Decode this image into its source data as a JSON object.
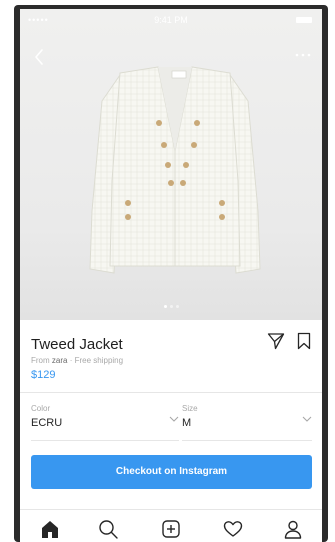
{
  "status_bar": {
    "signal": "•••••",
    "time": "9:41 PM"
  },
  "product": {
    "title": "Tweed Jacket",
    "from_prefix": "From",
    "brand": "zara",
    "shipping": "· Free shipping",
    "price": "$129",
    "image_pages": 3,
    "active_page": 1
  },
  "selectors": {
    "color": {
      "label": "Color",
      "value": "ECRU"
    },
    "size": {
      "label": "Size",
      "value": "M"
    }
  },
  "checkout": {
    "label": "Checkout on Instagram"
  },
  "icons": {
    "back": "chevron-left-icon",
    "more": "more-horizontal-icon",
    "share": "send-icon",
    "save": "bookmark-icon",
    "nav": [
      "home-icon",
      "search-icon",
      "add-post-icon",
      "heart-icon",
      "profile-icon"
    ]
  },
  "colors": {
    "accent": "#3897f0",
    "text": "#262626",
    "muted": "#a8a8a8"
  }
}
